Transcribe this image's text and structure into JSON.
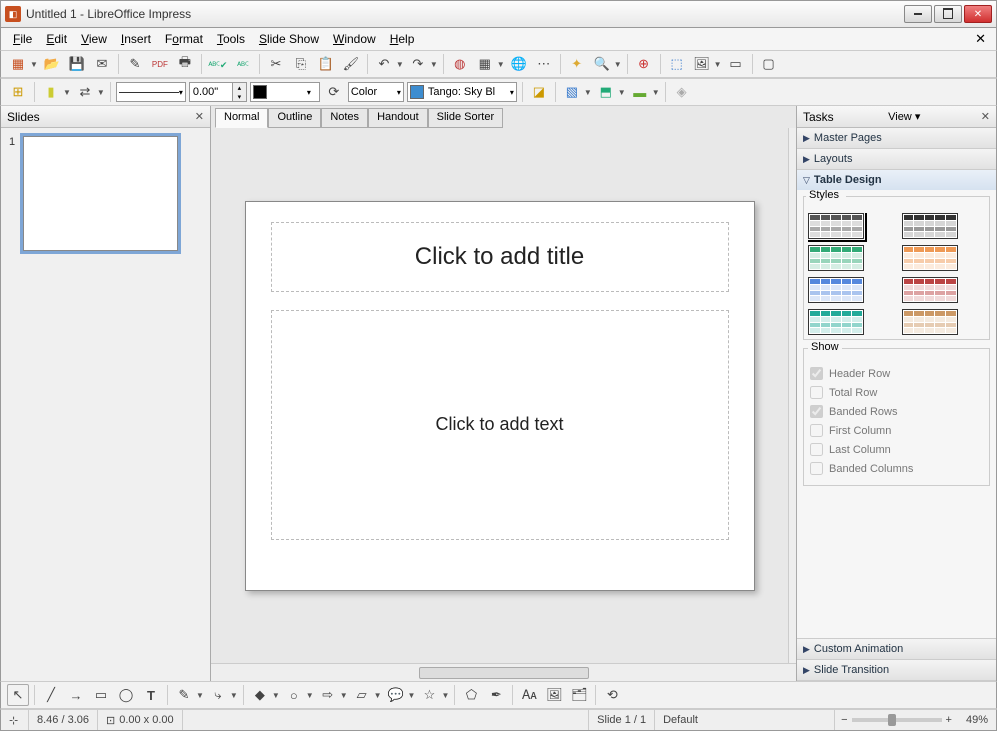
{
  "window": {
    "title": "Untitled 1 - LibreOffice Impress"
  },
  "menu": {
    "items": [
      "File",
      "Edit",
      "View",
      "Insert",
      "Format",
      "Tools",
      "Slide Show",
      "Window",
      "Help"
    ]
  },
  "toolbar2": {
    "lineWidth": "0.00\"",
    "colorLabel": "Color",
    "fillSwatch": "#3d8dd0",
    "fillName": "Tango: Sky Bl"
  },
  "slidesPanel": {
    "title": "Slides",
    "slides": [
      {
        "num": "1"
      }
    ]
  },
  "viewTabs": [
    "Normal",
    "Outline",
    "Notes",
    "Handout",
    "Slide Sorter"
  ],
  "placeholders": {
    "title": "Click to add title",
    "body": "Click to add text"
  },
  "tasksPanel": {
    "title": "Tasks",
    "viewLabel": "View",
    "sections": {
      "masterPages": "Master Pages",
      "layouts": "Layouts",
      "tableDesign": "Table Design",
      "customAnimation": "Custom Animation",
      "slideTransition": "Slide Transition"
    },
    "stylesLabel": "Styles",
    "showLabel": "Show",
    "showOptions": [
      {
        "label": "Header Row",
        "checked": true
      },
      {
        "label": "Total Row",
        "checked": false
      },
      {
        "label": "Banded Rows",
        "checked": true
      },
      {
        "label": "First Column",
        "checked": false
      },
      {
        "label": "Last Column",
        "checked": false
      },
      {
        "label": "Banded Columns",
        "checked": false
      }
    ],
    "styleColors": [
      "#555",
      "#333",
      "#3a7",
      "#e95",
      "#58d",
      "#b44",
      "#2a9",
      "#c96"
    ]
  },
  "status": {
    "coords": "8.46 / 3.06",
    "size": "0.00 x 0.00",
    "slide": "Slide 1 / 1",
    "template": "Default",
    "zoom": "49%"
  }
}
